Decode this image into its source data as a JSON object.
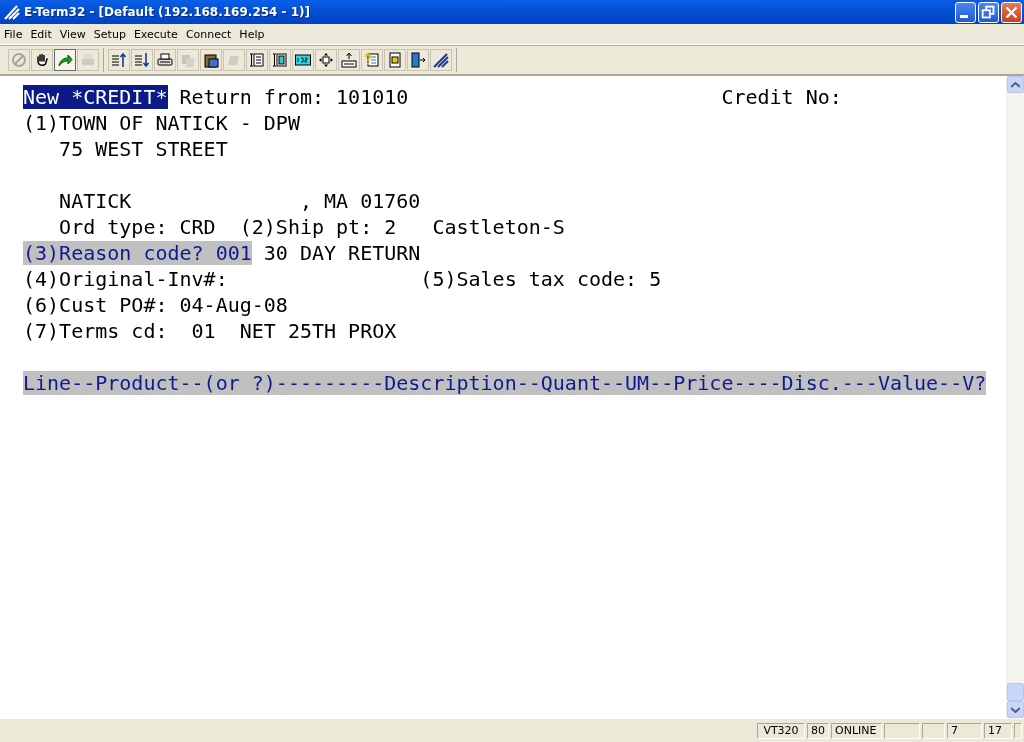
{
  "window": {
    "title": "E-Term32 - [Default (192.168.169.254 - 1)]"
  },
  "menu": [
    {
      "label": "File"
    },
    {
      "label": "Edit"
    },
    {
      "label": "View"
    },
    {
      "label": "Setup"
    },
    {
      "label": "Execute"
    },
    {
      "label": "Connect"
    },
    {
      "label": "Help"
    }
  ],
  "toolbar": [
    [
      {
        "disabled": true,
        "pressed": false
      },
      {
        "disabled": false,
        "pressed": false
      },
      {
        "disabled": false,
        "pressed": true
      },
      {
        "disabled": true,
        "pressed": false
      }
    ],
    [
      {
        "disabled": false,
        "pressed": false
      },
      {
        "disabled": false,
        "pressed": false
      },
      {
        "disabled": false,
        "pressed": false
      },
      {
        "disabled": true,
        "pressed": false
      },
      {
        "disabled": false,
        "pressed": false
      },
      {
        "disabled": true,
        "pressed": false
      },
      {
        "disabled": false,
        "pressed": false
      },
      {
        "disabled": false,
        "pressed": false
      },
      {
        "disabled": false,
        "pressed": false
      },
      {
        "disabled": false,
        "pressed": false
      },
      {
        "disabled": false,
        "pressed": false
      },
      {
        "disabled": false,
        "pressed": false
      },
      {
        "disabled": false,
        "pressed": false
      },
      {
        "disabled": false,
        "pressed": false
      },
      {
        "disabled": false,
        "pressed": false
      }
    ]
  ],
  "terminal": {
    "lines": [
      {
        "kind": "text",
        "segments": [
          {
            "text": "New *CREDIT*",
            "kind": "inverse"
          },
          {
            "text": " Return from: 101010                          Credit No:",
            "kind": "normal"
          }
        ]
      },
      {
        "kind": "text",
        "segments": [
          {
            "text": "(1)TOWN OF NATICK - DPW",
            "kind": "normal"
          }
        ]
      },
      {
        "kind": "text",
        "segments": [
          {
            "text": "   75 WEST STREET",
            "kind": "normal"
          }
        ]
      },
      {
        "kind": "blank"
      },
      {
        "kind": "text",
        "segments": [
          {
            "text": "   NATICK              , MA 01760",
            "kind": "normal"
          }
        ]
      },
      {
        "kind": "text",
        "segments": [
          {
            "text": "   Ord type: CRD  (2)Ship pt: 2   Castleton-S",
            "kind": "normal"
          }
        ]
      },
      {
        "kind": "text",
        "segments": [
          {
            "text": "(3)Reason code? 001",
            "kind": "field"
          },
          {
            "text": " 30 DAY RETURN",
            "kind": "normal"
          }
        ]
      },
      {
        "kind": "text",
        "segments": [
          {
            "text": "(4)Original-Inv#:                (5)Sales tax code: 5",
            "kind": "normal"
          }
        ]
      },
      {
        "kind": "text",
        "segments": [
          {
            "text": "(6)Cust PO#: 04-Aug-08",
            "kind": "normal"
          }
        ]
      },
      {
        "kind": "text",
        "segments": [
          {
            "text": "(7)Terms cd:  01  NET 25TH PROX",
            "kind": "normal"
          }
        ]
      },
      {
        "kind": "blank"
      },
      {
        "kind": "text",
        "segments": [
          {
            "text": "Line--Product--(or ?)---------Description--Quant--UM--Price----Disc.---Value--V?",
            "kind": "field"
          }
        ]
      }
    ]
  },
  "status_bar": [
    {
      "kind": "text",
      "text": "VT320"
    },
    {
      "kind": "text",
      "text": "80"
    },
    {
      "kind": "text",
      "text": "ONLINE"
    },
    {
      "kind": "empty"
    },
    {
      "kind": "empty"
    },
    {
      "kind": "text",
      "text": "7"
    },
    {
      "kind": "text",
      "text": "17"
    },
    {
      "kind": "empty"
    }
  ]
}
